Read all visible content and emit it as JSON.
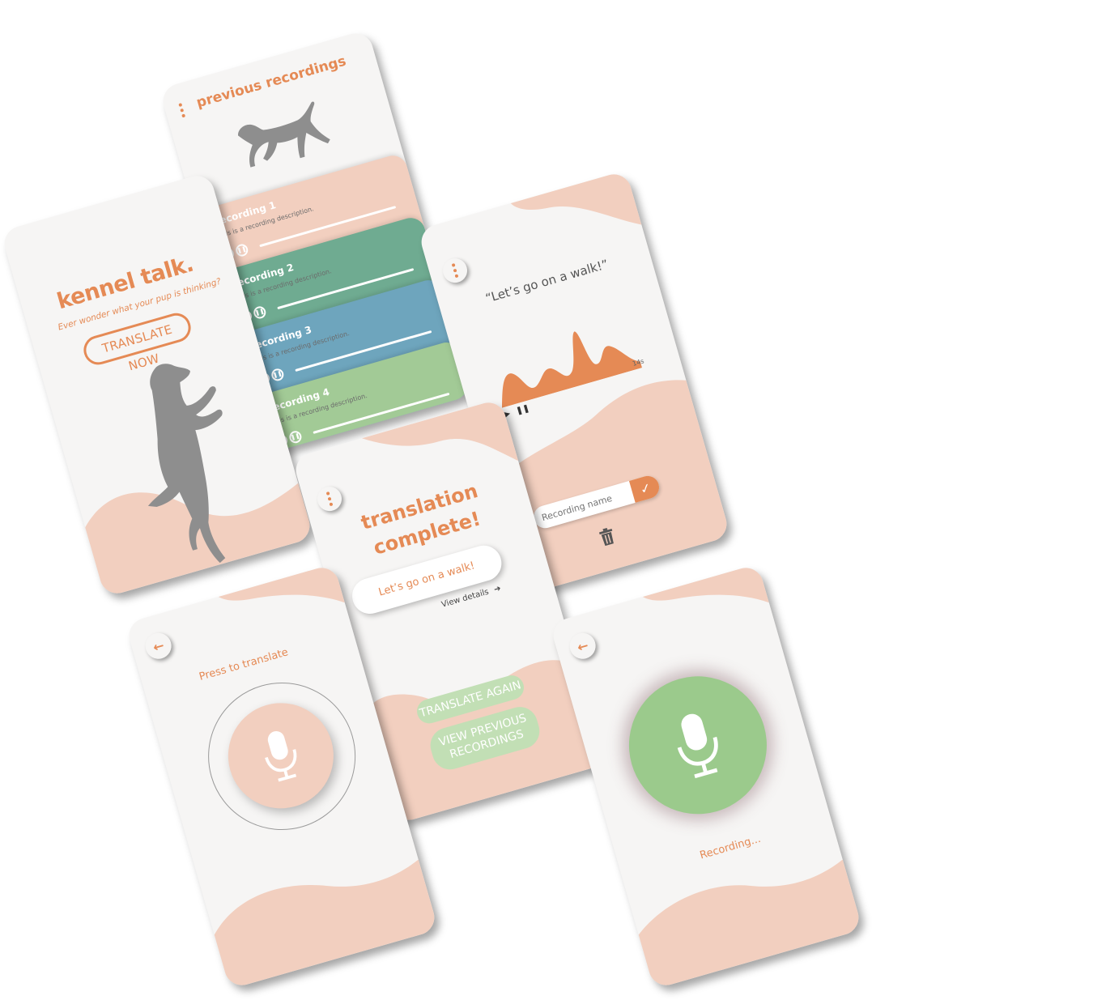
{
  "colors": {
    "accent": "#e58a55",
    "peach": "#f2cfbf",
    "background": "#f6f5f4",
    "dog": "#8e8e8e",
    "recording_1": "#f2cfbf",
    "recording_2": "#6fab91",
    "recording_3": "#6ea5bd",
    "recording_4": "#a2ca96",
    "mic_green": "#9bca8c"
  },
  "home": {
    "title": "kennel talk.",
    "subtitle": "Ever wonder what your pup is thinking?",
    "cta_label": "TRANSLATE NOW",
    "dog_icon": "dog-jumping-silhouette"
  },
  "previous": {
    "title": "previous recordings",
    "menu_icon": "kebab-menu-icon",
    "dog_icon": "dog-running-silhouette",
    "recordings": [
      {
        "title": "Recording 1",
        "description": "This is a recording description."
      },
      {
        "title": "Recording 2",
        "description": "This is a recording description."
      },
      {
        "title": "Recording 3",
        "description": "This is a recording description."
      },
      {
        "title": "Recording 4",
        "description": "This is a recording description."
      }
    ]
  },
  "detail": {
    "quote": "“Let’s go on a walk!”",
    "duration": "14s",
    "name_placeholder": "Recording name",
    "confirm_icon": "checkmark-icon",
    "delete_icon": "trash-icon"
  },
  "complete": {
    "title_line1": "translation",
    "title_line2": "complete!",
    "result": "Let’s go on a walk!",
    "view_details": "View details",
    "translate_again": "TRANSLATE AGAIN",
    "view_previous_line1": "VIEW PREVIOUS",
    "view_previous_line2": "RECORDINGS"
  },
  "press": {
    "label": "Press to translate",
    "back_icon": "back-arrow-icon",
    "mic_icon": "microphone-icon"
  },
  "recording": {
    "status": "Recording...",
    "back_icon": "back-arrow-icon",
    "mic_icon": "microphone-icon"
  }
}
